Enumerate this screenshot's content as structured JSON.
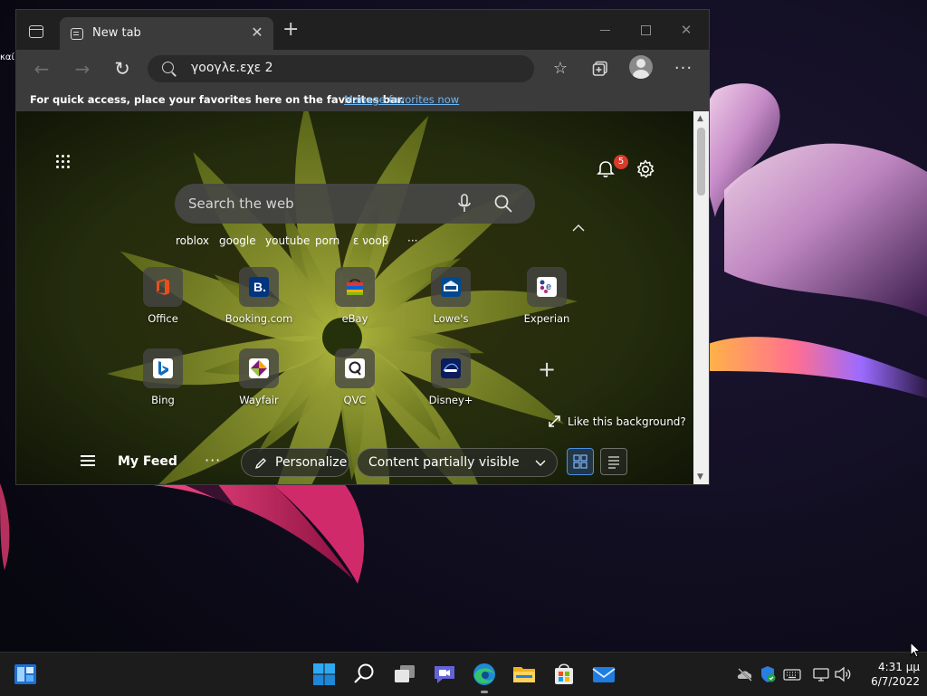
{
  "desktop": {
    "edge_text": "καί"
  },
  "browser": {
    "tab": {
      "title": "New tab",
      "close": "✕"
    },
    "new_tab": "+",
    "address": {
      "value": "γοογλε.εχε 2"
    },
    "favorites_bar": {
      "message": "For quick access, place your favorites here on the favorites bar.",
      "link": "Manage favorites now"
    }
  },
  "newtab": {
    "notification_count": "5",
    "search": {
      "placeholder": "Search the web"
    },
    "suggestions": [
      "roblox",
      "google",
      "youtube",
      "porn",
      "ε νοοβ",
      "···"
    ],
    "tiles": [
      {
        "label": "Office",
        "icon": "office-icon"
      },
      {
        "label": "Booking.com",
        "icon": "booking-icon"
      },
      {
        "label": "eBay",
        "icon": "ebay-icon"
      },
      {
        "label": "Lowe's",
        "icon": "lowes-icon"
      },
      {
        "label": "Experian",
        "icon": "experian-icon"
      },
      {
        "label": "Bing",
        "icon": "bing-icon"
      },
      {
        "label": "Wayfair",
        "icon": "wayfair-icon"
      },
      {
        "label": "QVC",
        "icon": "qvc-icon"
      },
      {
        "label": "Disney+",
        "icon": "disney-icon"
      }
    ],
    "add_tile": "+",
    "like_background": "Like this background?",
    "feed": {
      "title": "My Feed",
      "more": "···",
      "personalize": "Personalize",
      "content_visibility": "Content partially visible"
    }
  },
  "taskbar": {
    "apps": [
      "widgets-icon",
      "start-icon",
      "search-icon",
      "task-view-icon",
      "teams-chat-icon",
      "edge-icon",
      "file-explorer-icon",
      "store-icon",
      "mail-icon"
    ],
    "clock": {
      "time": "4:31 μμ",
      "date": "6/7/2022"
    }
  }
}
